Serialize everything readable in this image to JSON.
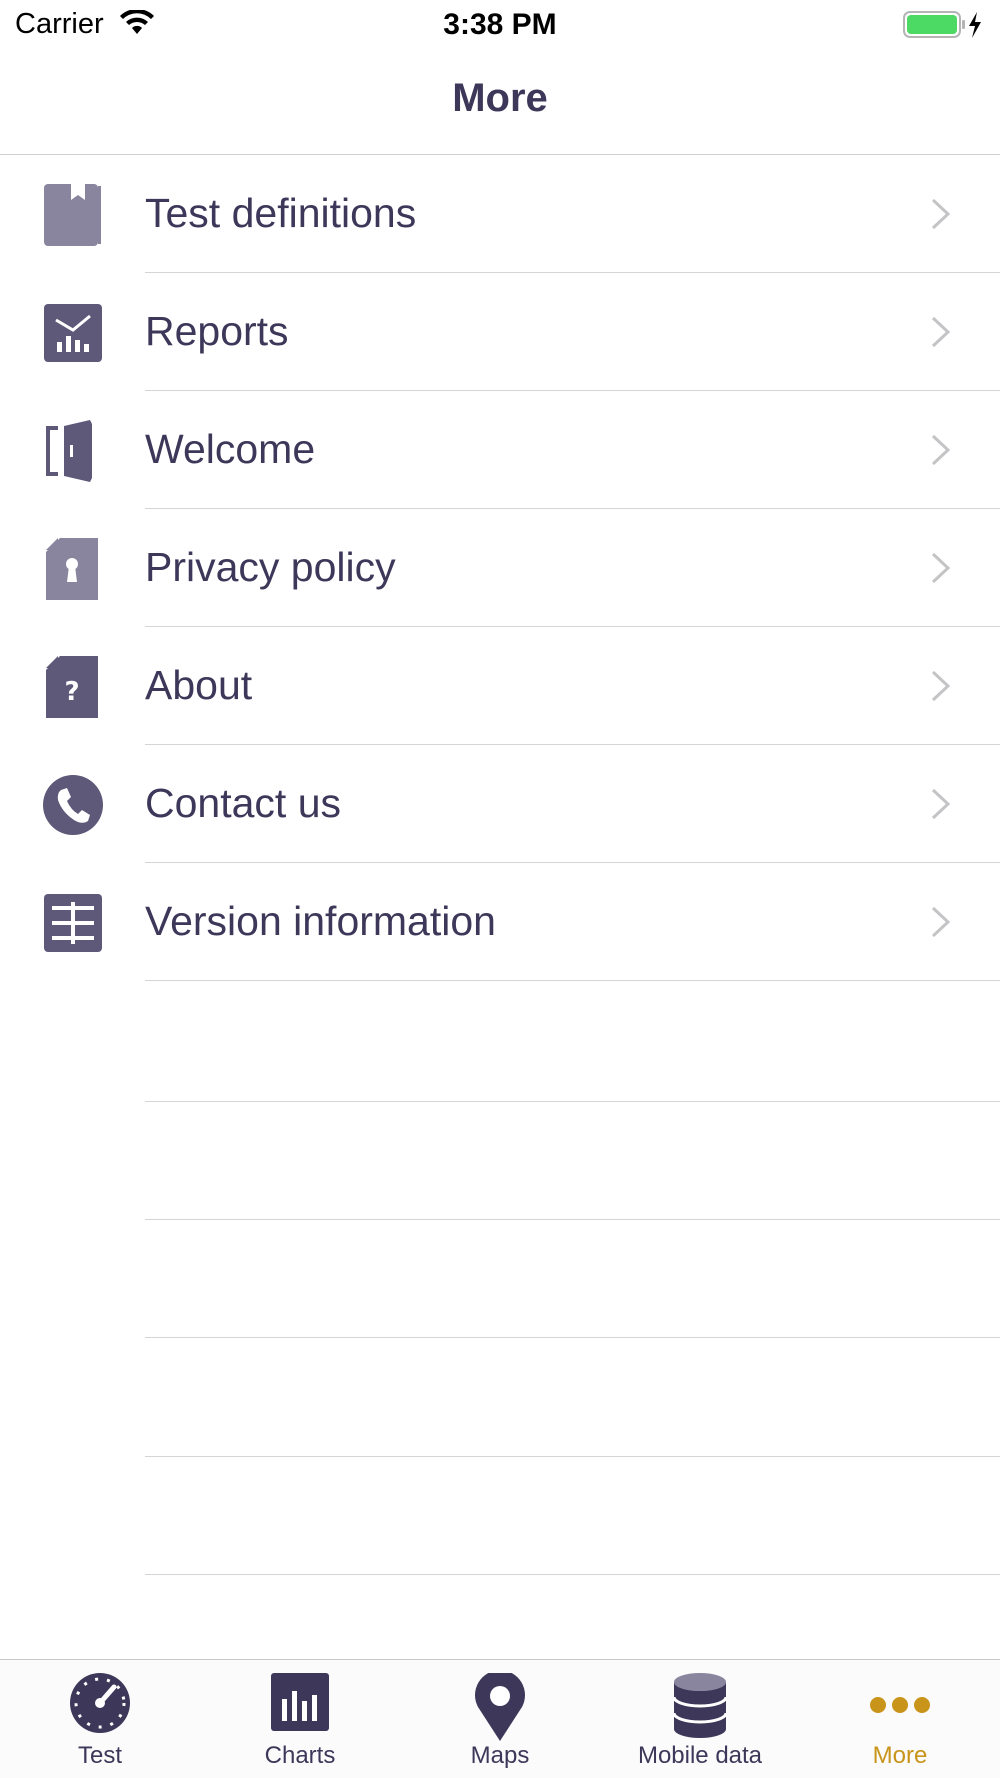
{
  "status_bar": {
    "carrier": "Carrier",
    "time": "3:38 PM",
    "battery_color": "#4cd964"
  },
  "nav": {
    "title": "More"
  },
  "menu": {
    "items": [
      {
        "label": "Test definitions",
        "icon": "book-icon"
      },
      {
        "label": "Reports",
        "icon": "report-chart-icon"
      },
      {
        "label": "Welcome",
        "icon": "door-icon"
      },
      {
        "label": "Privacy policy",
        "icon": "document-lock-icon"
      },
      {
        "label": "About",
        "icon": "document-question-icon"
      },
      {
        "label": "Contact us",
        "icon": "phone-icon"
      },
      {
        "label": "Version information",
        "icon": "table-icon"
      }
    ]
  },
  "tab_bar": {
    "tabs": [
      {
        "label": "Test",
        "icon": "speedometer-icon"
      },
      {
        "label": "Charts",
        "icon": "bar-chart-icon"
      },
      {
        "label": "Maps",
        "icon": "map-pin-icon"
      },
      {
        "label": "Mobile data",
        "icon": "database-icon"
      },
      {
        "label": "More",
        "icon": "more-dots-icon"
      }
    ],
    "active": "More"
  },
  "colors": {
    "primary": "#3d3859",
    "icon": "#6b6585",
    "accent": "#c9941a",
    "chevron": "#c4c4c7"
  }
}
